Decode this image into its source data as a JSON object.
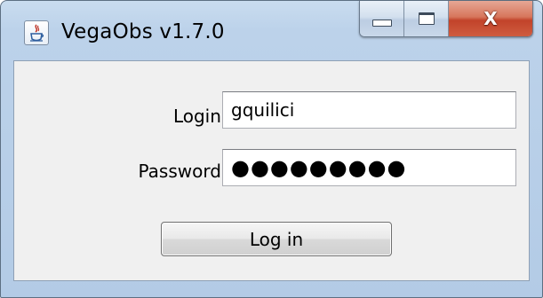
{
  "window": {
    "title": "VegaObs v1.7.0",
    "app_icon": "java-cup-icon",
    "controls": {
      "minimize_icon": "minimize-icon",
      "maximize_icon": "maximize-icon",
      "close_icon": "close-icon",
      "close_glyph": "X"
    }
  },
  "form": {
    "login_label": "Login :",
    "login_value": "gquilici",
    "password_label": "Password :",
    "password_masked": "●●●●●●●●●",
    "submit_label": "Log in"
  },
  "colors": {
    "titlebar": "#bcd2ea",
    "close_button": "#c2432a",
    "client_bg": "#f0f0f0"
  }
}
